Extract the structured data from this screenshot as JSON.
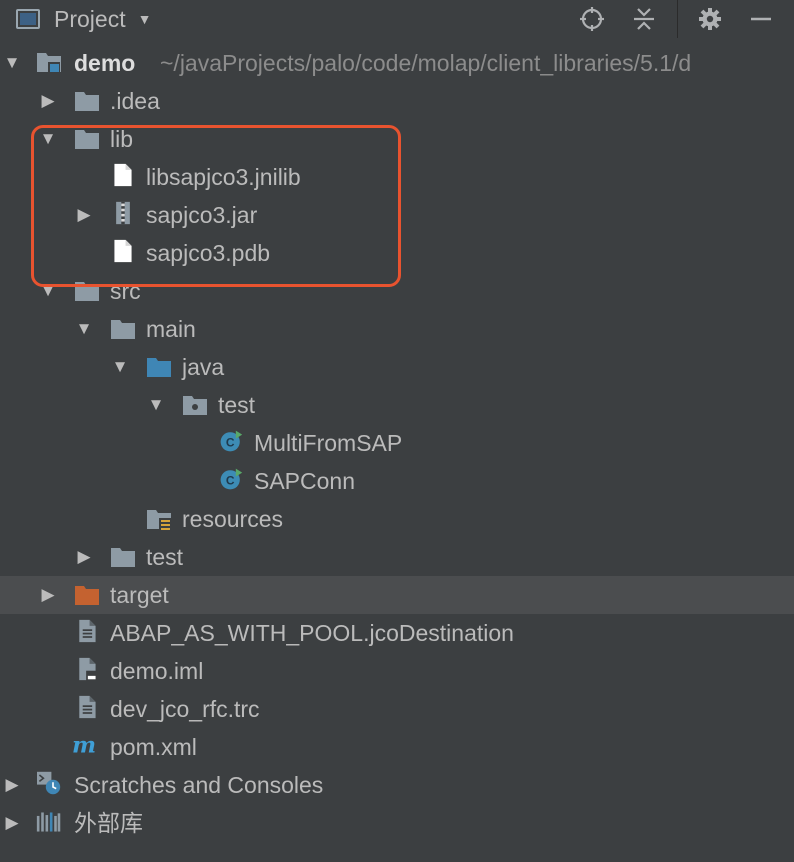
{
  "header": {
    "title": "Project",
    "icons": [
      "project-view-icon",
      "caret-down-icon",
      "locate-target-icon",
      "collapse-all-icon",
      "gear-icon",
      "minimize-icon"
    ]
  },
  "tree": {
    "root_label": "demo",
    "root_path": "~/javaProjects/palo/code/molap/client_libraries/5.1/d",
    "items": [
      {
        "label": "demo"
      },
      {
        "label": ".idea"
      },
      {
        "label": "lib"
      },
      {
        "label": "libsapjco3.jnilib"
      },
      {
        "label": "sapjco3.jar"
      },
      {
        "label": "sapjco3.pdb"
      },
      {
        "label": "src"
      },
      {
        "label": "main"
      },
      {
        "label": "java"
      },
      {
        "label": "test"
      },
      {
        "label": "MultiFromSAP"
      },
      {
        "label": "SAPConn"
      },
      {
        "label": "resources"
      },
      {
        "label": "test"
      },
      {
        "label": "target"
      },
      {
        "label": "ABAP_AS_WITH_POOL.jcoDestination"
      },
      {
        "label": "demo.iml"
      },
      {
        "label": "dev_jco_rfc.trc"
      },
      {
        "label": "pom.xml"
      },
      {
        "label": "Scratches and Consoles"
      },
      {
        "label": "外部库"
      }
    ]
  },
  "colors": {
    "background": "#3c3f41",
    "selection": "#4b4d4f",
    "folder": "#8e9ba5",
    "source_folder": "#3f86b5",
    "excluded_folder": "#c46230",
    "highlight": "#e8532f",
    "class_icon": "#3d8cb5",
    "maven": "#3f9fd6"
  }
}
